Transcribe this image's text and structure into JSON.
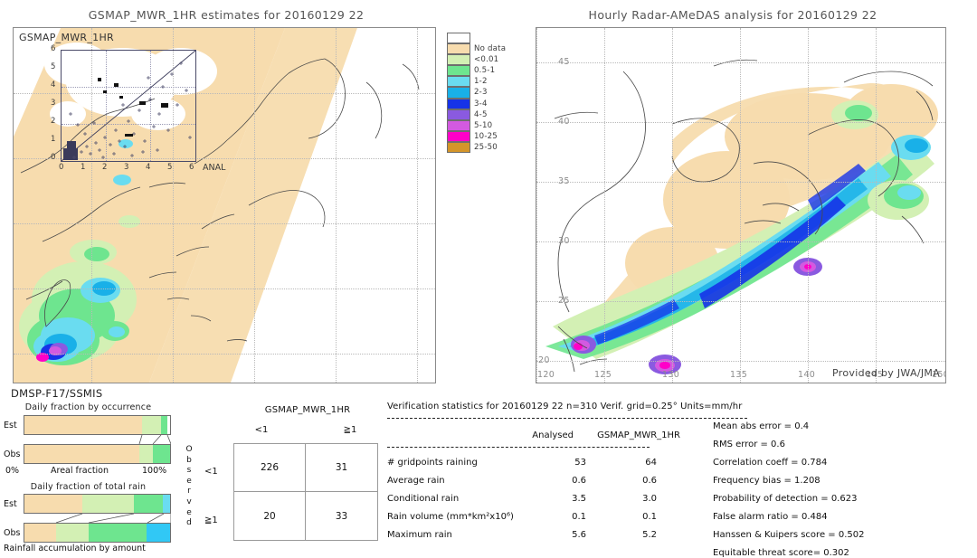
{
  "left_panel": {
    "title": "GSMAP_MWR_1HR estimates for 20160129 22",
    "map_tag": "GSMAP_MWR_1HR",
    "scatter": {
      "x_label": "ANAL",
      "ticks": [
        "0",
        "1",
        "2",
        "3",
        "4",
        "5",
        "6"
      ],
      "x_ticks": [
        "0",
        "1",
        "2",
        "3",
        "4",
        "5",
        "6"
      ],
      "y_ticks": [
        "0",
        "1",
        "2",
        "3",
        "4",
        "5",
        "6"
      ],
      "axis_min": 0,
      "axis_max": 6
    }
  },
  "right_panel": {
    "title": "Hourly Radar-AMeDAS analysis for 20160129 22",
    "credit": "Provided by JWA/JMA",
    "lon_ticks": [
      "120",
      "125",
      "130",
      "135",
      "140",
      "145",
      "150"
    ],
    "lat_ticks": [
      "20",
      "25",
      "30",
      "35",
      "40",
      "45"
    ]
  },
  "legend": {
    "entries": [
      {
        "label": "",
        "color": "#ffffff"
      },
      {
        "label": "No data",
        "color": "#f7dcae"
      },
      {
        "label": "<0.01",
        "color": "#d3f0b4"
      },
      {
        "label": "0.5-1",
        "color": "#6ee58f"
      },
      {
        "label": "1-2",
        "color": "#6adcf0"
      },
      {
        "label": "2-3",
        "color": "#19b0e8"
      },
      {
        "label": "3-4",
        "color": "#1633e8"
      },
      {
        "label": "4-5",
        "color": "#8a5ae0"
      },
      {
        "label": "5-10",
        "color": "#d35ae0"
      },
      {
        "label": "10-25",
        "color": "#ff00c8"
      },
      {
        "label": "25-50",
        "color": "#d4952a"
      }
    ]
  },
  "bars_section": {
    "sensor": "DMSP-F17/SSMIS",
    "chart1": {
      "title": "Daily fraction by occurrence",
      "rows": [
        {
          "label": "Est",
          "segments": [
            {
              "color": "#f7dcae",
              "pct": 80.5
            },
            {
              "color": "#d3f0b4",
              "pct": 13.0
            },
            {
              "color": "#6ee58f",
              "pct": 4.5
            },
            {
              "color": "#ffffff",
              "pct": 2.0
            }
          ]
        },
        {
          "label": "Obs",
          "segments": [
            {
              "color": "#f7dcae",
              "pct": 79.0
            },
            {
              "color": "#d3f0b4",
              "pct": 9.0
            },
            {
              "color": "#6ee58f",
              "pct": 12.0
            }
          ]
        }
      ],
      "axis_left": "0%",
      "axis_center": "Areal fraction",
      "axis_right": "100%"
    },
    "chart2": {
      "title": "Daily fraction of total rain",
      "rows": [
        {
          "label": "Est",
          "segments": [
            {
              "color": "#f7dcae",
              "pct": 40.0
            },
            {
              "color": "#d3f0b4",
              "pct": 35.0
            },
            {
              "color": "#6ee58f",
              "pct": 20.0
            },
            {
              "color": "#6adcf0",
              "pct": 5.0
            }
          ]
        },
        {
          "label": "Obs",
          "segments": [
            {
              "color": "#f7dcae",
              "pct": 22.0
            },
            {
              "color": "#d3f0b4",
              "pct": 22.0
            },
            {
              "color": "#6ee58f",
              "pct": 40.0
            },
            {
              "color": "#31c8f5",
              "pct": 16.0
            }
          ]
        }
      ],
      "caption": "Rainfall accumulation by amount"
    }
  },
  "contingency": {
    "title": "GSMAP_MWR_1HR",
    "col_headers": [
      "<1",
      "≧1"
    ],
    "row_headers": [
      "<1",
      "≧1"
    ],
    "observed_label": "Observed",
    "cells": [
      [
        "226",
        "31"
      ],
      [
        "20",
        "33"
      ]
    ]
  },
  "verification": {
    "header": "Verification statistics for 20160129 22   n=310  Verif. grid=0.25°  Units=mm/hr",
    "col_analysed": "Analysed",
    "col_model": "GSMAP_MWR_1HR",
    "rows": [
      {
        "name": "# gridpoints raining",
        "analysed": "53",
        "model": "64"
      },
      {
        "name": "Average rain",
        "analysed": "0.6",
        "model": "0.6"
      },
      {
        "name": "Conditional rain",
        "analysed": "3.5",
        "model": "3.0"
      },
      {
        "name": "Rain volume (mm*km²x10⁶)",
        "analysed": "0.1",
        "model": "0.1"
      },
      {
        "name": "Maximum rain",
        "analysed": "5.6",
        "model": "5.2"
      }
    ],
    "metrics": [
      "Mean abs error = 0.4",
      "RMS error = 0.6",
      "Correlation coeff = 0.784",
      "Frequency bias = 1.208",
      "Probability of detection = 0.623",
      "False alarm ratio = 0.484",
      "Hanssen & Kuipers score = 0.502",
      "Equitable threat score= 0.302"
    ]
  }
}
